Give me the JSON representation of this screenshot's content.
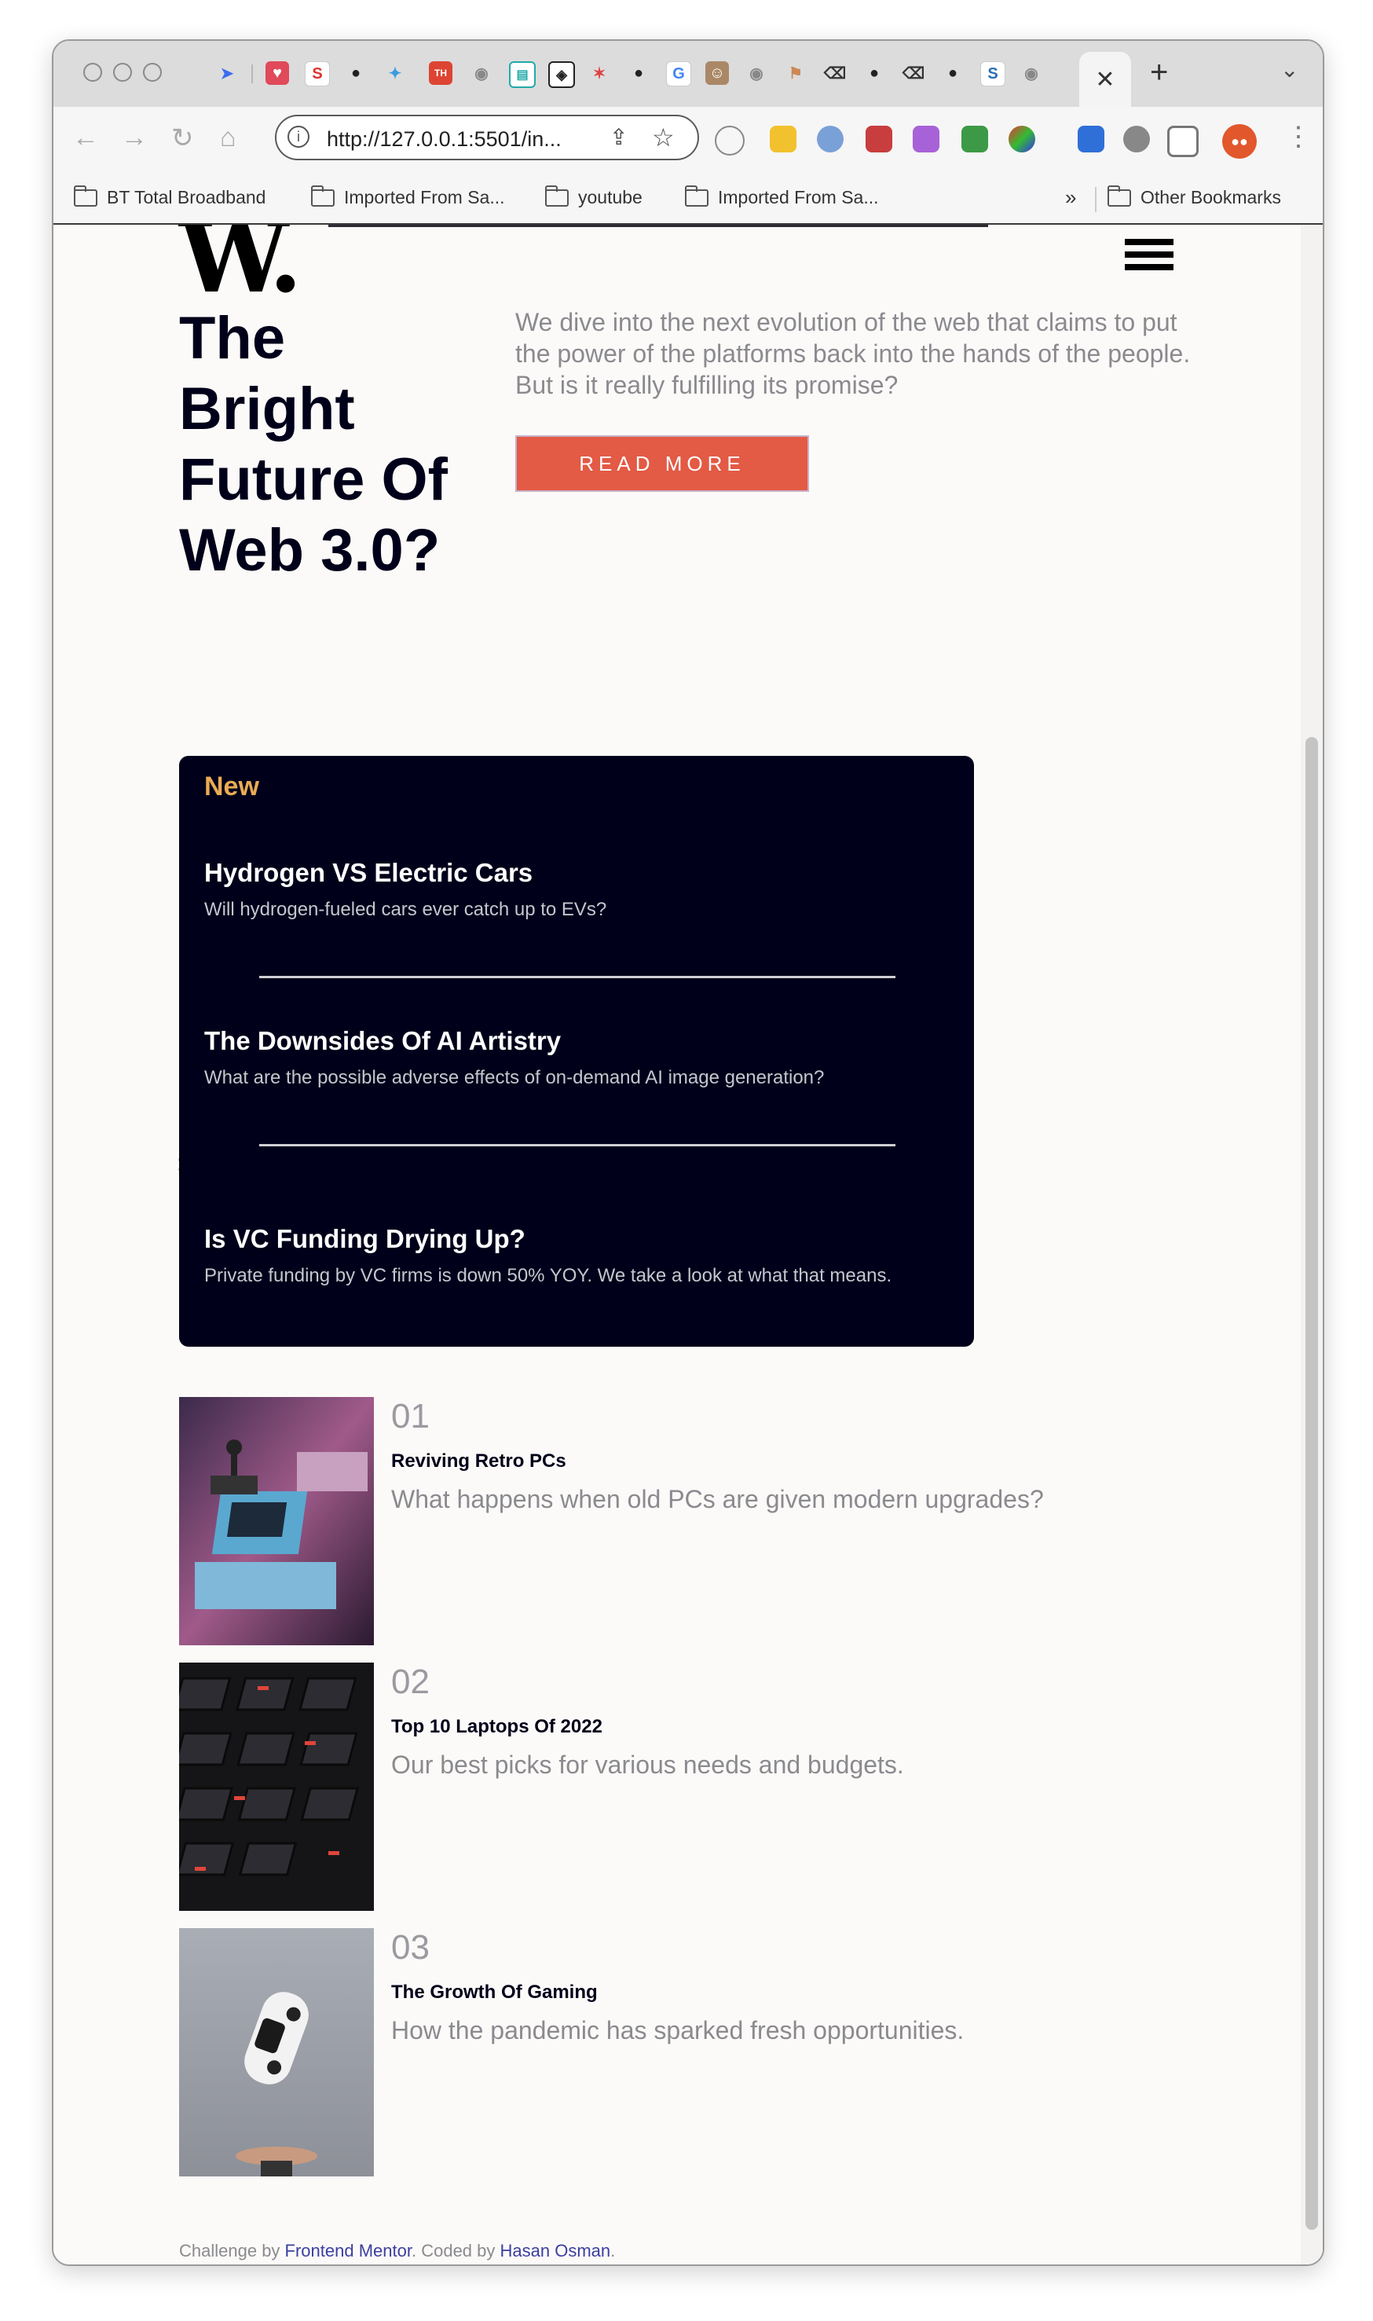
{
  "browser": {
    "url": "http://127.0.0.1:5501/in...",
    "active_tab_close": "✕",
    "new_tab": "+",
    "bookmarks": [
      "BT Total Broadband",
      "Imported From Sa...",
      "youtube",
      "Imported From Sa..."
    ],
    "bookmarks_more": "»",
    "other_bookmarks": "Other Bookmarks"
  },
  "site": {
    "logo": "W."
  },
  "hero": {
    "title": "The Bright Future Of Web 3.0?",
    "description": "We dive into the next evolution of the web that claims to put the power of the platforms back into the hands of the people. But is it really fulfilling its promise?",
    "button": "READ MORE"
  },
  "new_section": {
    "heading": "New",
    "items": [
      {
        "title": "Hydrogen VS Electric Cars",
        "text": "Will hydrogen-fueled cars ever catch up to EVs?"
      },
      {
        "title": "The Downsides Of AI Artistry",
        "text": "What are the possible adverse effects of on-demand AI image generation?"
      },
      {
        "title": "Is VC Funding Drying Up?",
        "text": "Private funding by VC firms is down 50% YOY. We take a look at what that means."
      }
    ],
    "stray_char": ";"
  },
  "articles": [
    {
      "num": "01",
      "title": "Reviving Retro PCs",
      "text": "What happens when old PCs are given modern upgrades?"
    },
    {
      "num": "02",
      "title": "Top 10 Laptops Of 2022",
      "text": "Our best picks for various needs and budgets."
    },
    {
      "num": "03",
      "title": "The Growth Of Gaming",
      "text": "How the pandemic has sparked fresh opportunities."
    }
  ],
  "footer": {
    "prefix": "Challenge by ",
    "link1": "Frontend Mentor",
    "middle": ". Coded by ",
    "link2": "Hasan Osman",
    "suffix": "."
  }
}
